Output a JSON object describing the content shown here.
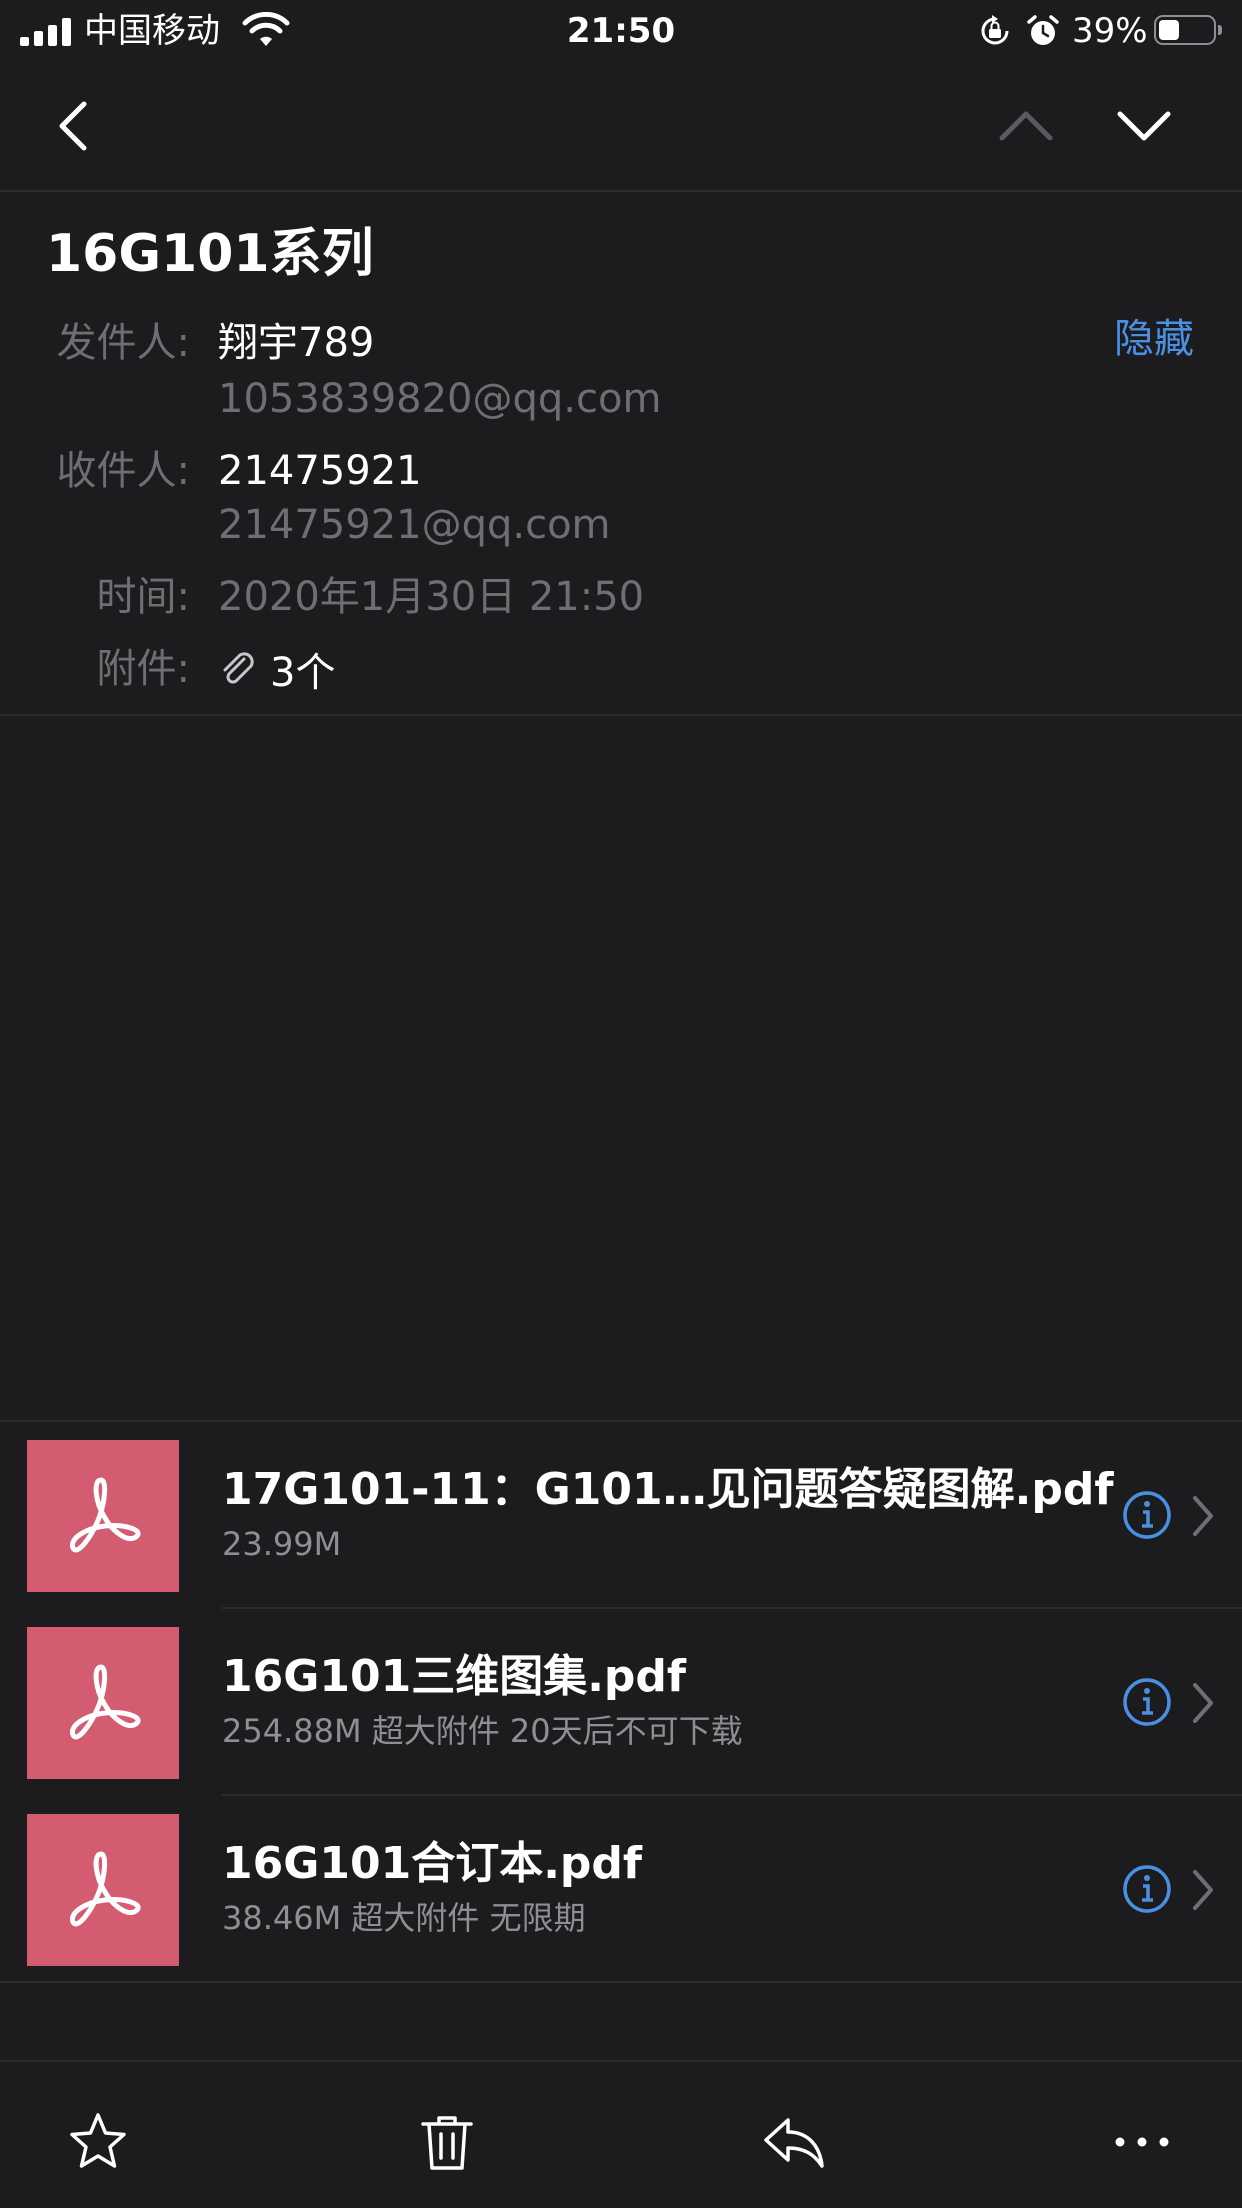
{
  "status_bar": {
    "carrier": "中国移动",
    "time": "21:50",
    "battery": "39%",
    "battery_level": 0.39
  },
  "nav": {
    "back_icon": "chevron-left-icon",
    "prev_icon": "chevron-up-icon",
    "next_icon": "chevron-down-icon"
  },
  "mail": {
    "subject": "16G101系列",
    "hide_label": "隐藏",
    "from_label": "发件人:",
    "from_name": "翔宇789",
    "from_email": "1053839820@qq.com",
    "to_label": "收件人:",
    "to_name": "21475921",
    "to_email": "21475921@qq.com",
    "time_label": "时间:",
    "time_value": "2020年1月30日 21:50",
    "attach_label": "附件:",
    "attach_count": "3个"
  },
  "attachments": [
    {
      "name": "17G101-11：G101…见问题答疑图解.pdf",
      "info": "23.99M",
      "icon": "pdf-icon"
    },
    {
      "name": "16G101三维图集.pdf",
      "info": "254.88M 超大附件 20天后不可下载",
      "icon": "pdf-icon"
    },
    {
      "name": "16G101合订本.pdf",
      "info": "38.46M 超大附件 无限期",
      "icon": "pdf-icon"
    }
  ],
  "toolbar": {
    "icons": [
      "star-icon",
      "trash-icon",
      "reply-icon",
      "more-icon"
    ]
  },
  "colors": {
    "background": "#1c1c1e",
    "accent": "#4a90e2",
    "pdf_tile": "#d45c71",
    "secondary_text": "#6e6e73"
  }
}
